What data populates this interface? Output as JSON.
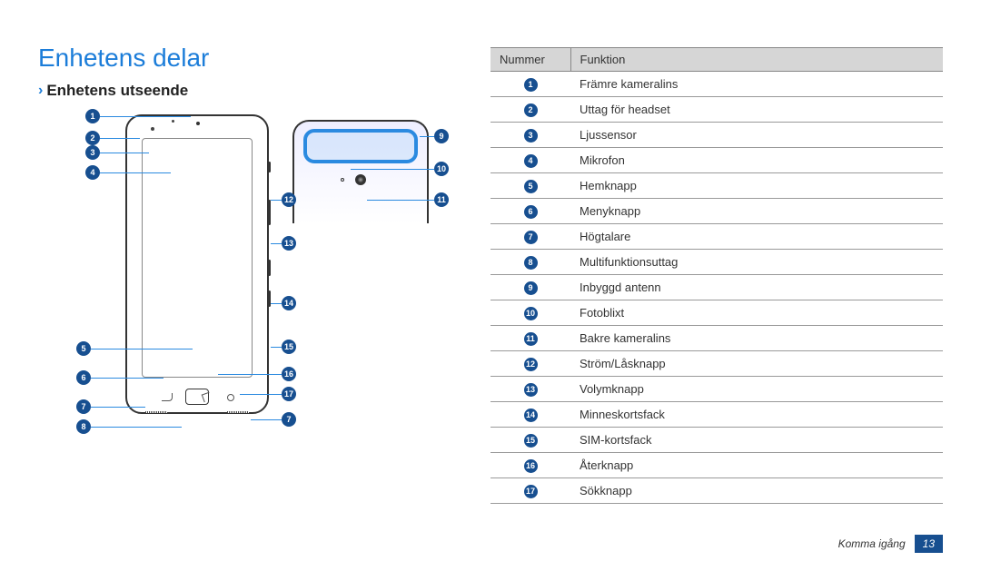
{
  "title": "Enhetens delar",
  "subtitle": "Enhetens utseende",
  "table": {
    "header_num": "Nummer",
    "header_fn": "Funktion",
    "rows": [
      {
        "n": "1",
        "fn": "Främre kameralins"
      },
      {
        "n": "2",
        "fn": "Uttag för headset"
      },
      {
        "n": "3",
        "fn": "Ljussensor"
      },
      {
        "n": "4",
        "fn": "Mikrofon"
      },
      {
        "n": "5",
        "fn": "Hemknapp"
      },
      {
        "n": "6",
        "fn": "Menyknapp"
      },
      {
        "n": "7",
        "fn": "Högtalare"
      },
      {
        "n": "8",
        "fn": "Multifunktionsuttag"
      },
      {
        "n": "9",
        "fn": "Inbyggd antenn"
      },
      {
        "n": "10",
        "fn": "Fotoblixt"
      },
      {
        "n": "11",
        "fn": "Bakre kameralins"
      },
      {
        "n": "12",
        "fn": "Ström/Låsknapp"
      },
      {
        "n": "13",
        "fn": "Volymknapp"
      },
      {
        "n": "14",
        "fn": "Minneskortsfack"
      },
      {
        "n": "15",
        "fn": "SIM-kortsfack"
      },
      {
        "n": "16",
        "fn": "Återknapp"
      },
      {
        "n": "17",
        "fn": "Sökknapp"
      }
    ]
  },
  "footer": {
    "section": "Komma igång",
    "page": "13"
  },
  "callout_labels": {
    "c1": "1",
    "c2": "2",
    "c3": "3",
    "c4": "4",
    "c5": "5",
    "c6": "6",
    "c7a": "7",
    "c7b": "7",
    "c8": "8",
    "c9": "9",
    "c10": "10",
    "c11": "11",
    "c12": "12",
    "c13": "13",
    "c14": "14",
    "c15": "15",
    "c16": "16",
    "c17": "17"
  }
}
